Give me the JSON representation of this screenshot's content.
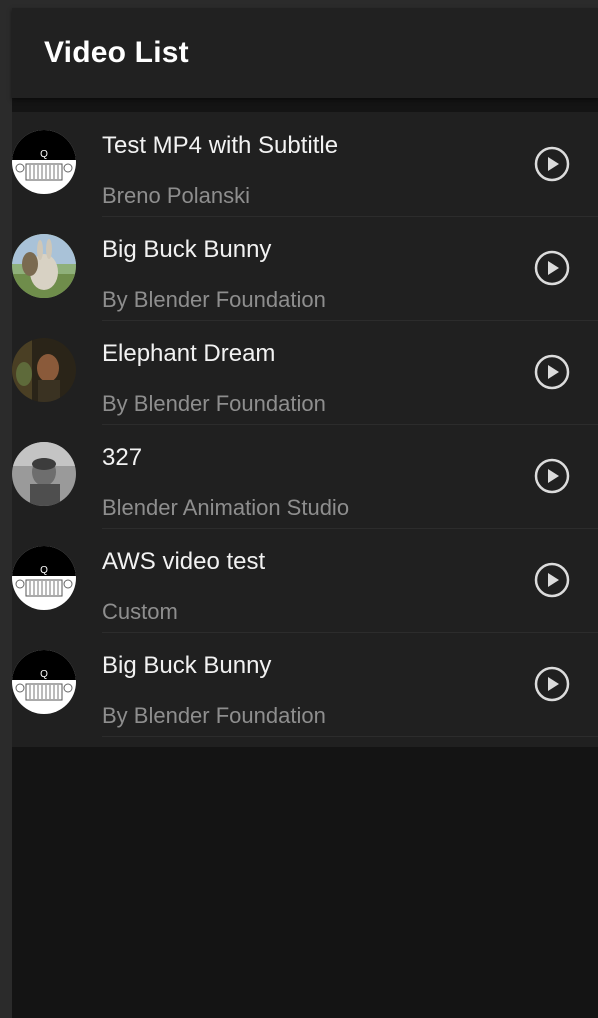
{
  "header": {
    "title": "Video List"
  },
  "videos": [
    {
      "title": "Test MP4 with Subtitle",
      "subtitle": "Breno Polanski",
      "thumb": "jeep-icon"
    },
    {
      "title": "Big Buck Bunny",
      "subtitle": "By Blender Foundation",
      "thumb": "bunny-thumbnail"
    },
    {
      "title": "Elephant Dream",
      "subtitle": "By Blender Foundation",
      "thumb": "elephant-dream-thumbnail"
    },
    {
      "title": "327",
      "subtitle": "Blender Animation Studio",
      "thumb": "327-thumbnail"
    },
    {
      "title": "AWS video test",
      "subtitle": "Custom",
      "thumb": "jeep-icon"
    },
    {
      "title": "Big Buck Bunny",
      "subtitle": "By Blender Foundation",
      "thumb": "jeep-icon"
    }
  ],
  "colors": {
    "header_bg": "#212121",
    "list_bg": "#202020",
    "page_bg": "#141414",
    "title_text": "#f2f2f2",
    "subtitle_text": "#8e8e8e",
    "play_icon": "#dcdcdc"
  }
}
